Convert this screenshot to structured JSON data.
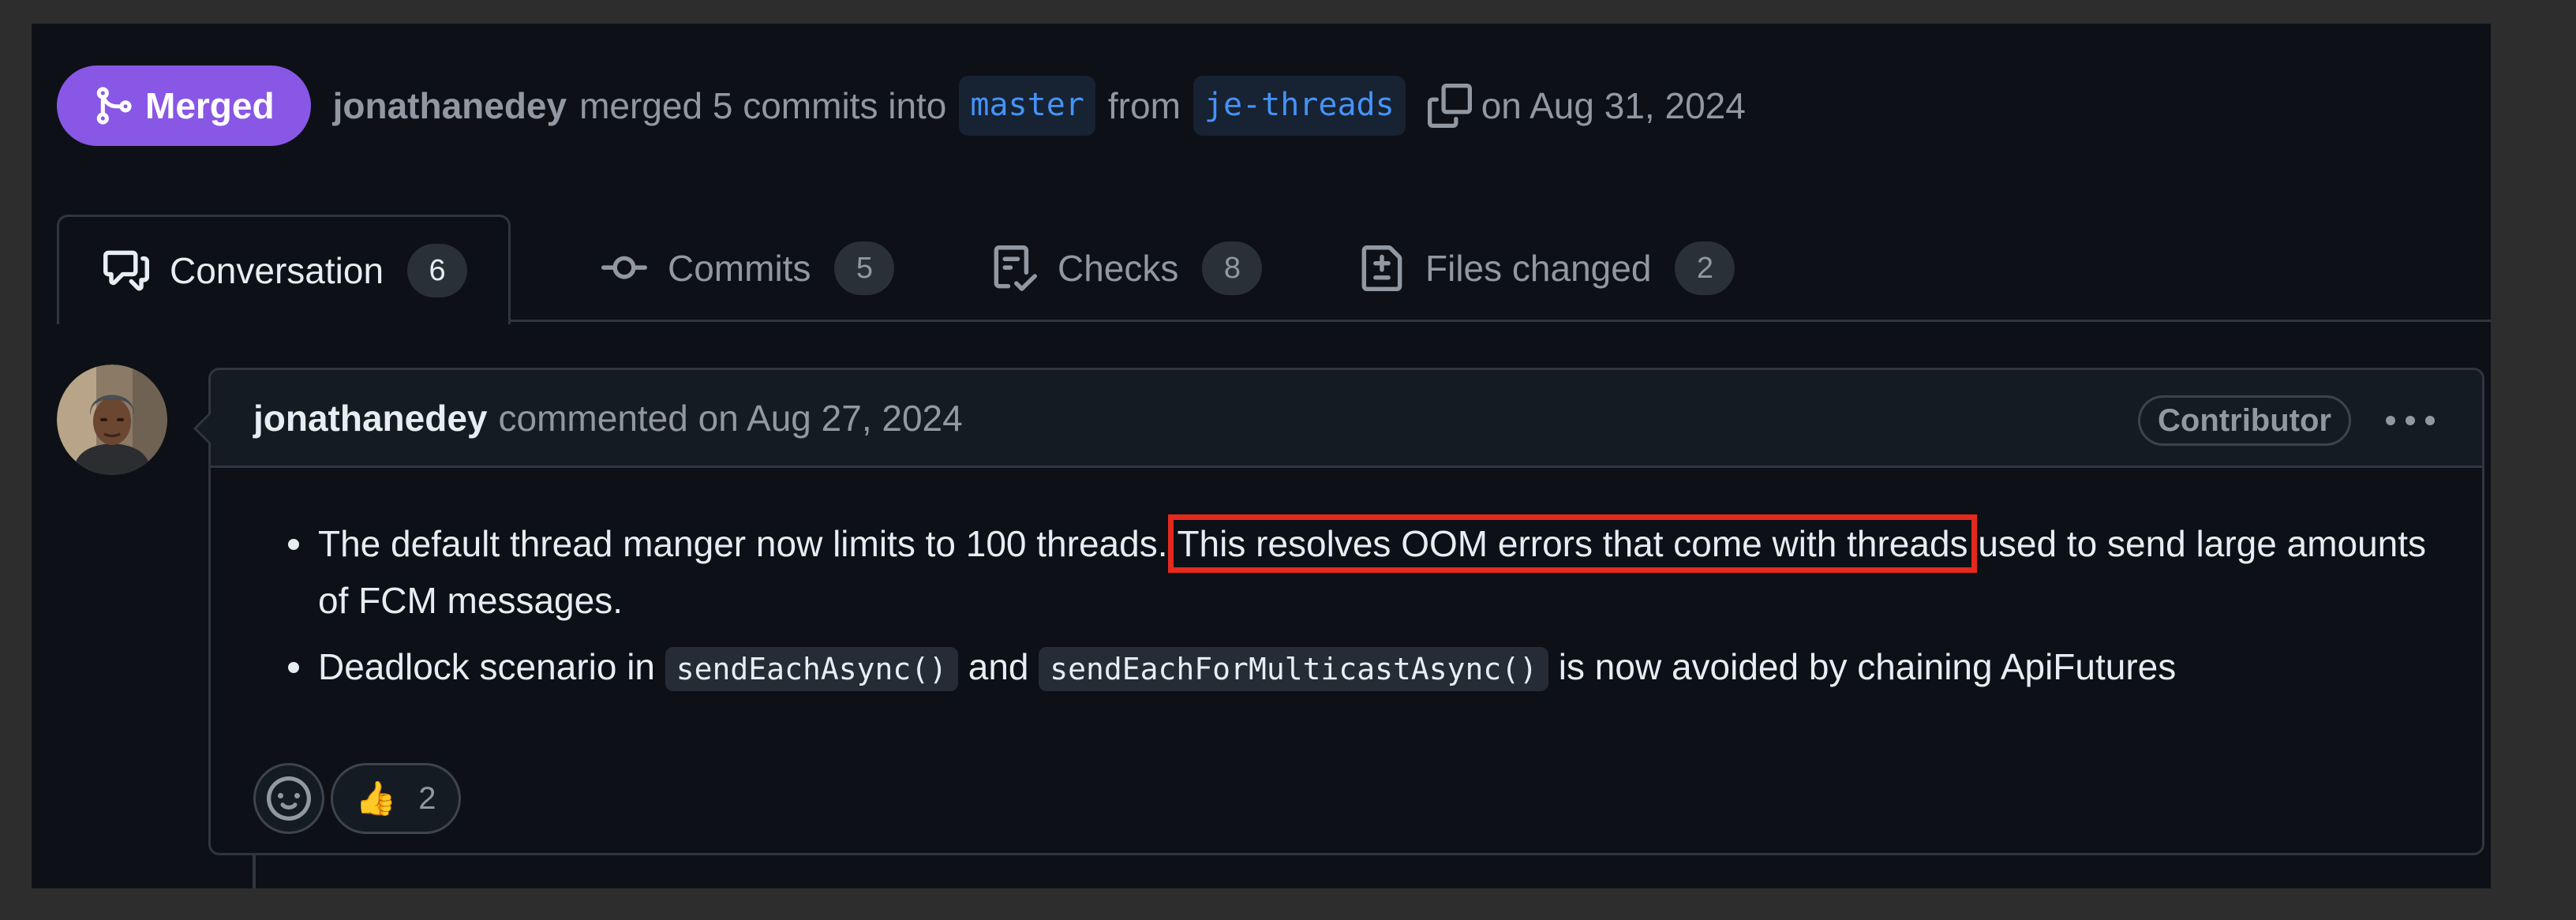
{
  "header": {
    "state": "Merged",
    "author": "jonathanedey",
    "action": "merged 5 commits into",
    "base_branch": "master",
    "from_word": "from",
    "head_branch": "je-threads",
    "date": "on Aug 31, 2024"
  },
  "tabs": [
    {
      "label": "Conversation",
      "count": "6"
    },
    {
      "label": "Commits",
      "count": "5"
    },
    {
      "label": "Checks",
      "count": "8"
    },
    {
      "label": "Files changed",
      "count": "2"
    }
  ],
  "comment": {
    "author": "jonathanedey",
    "meta": "commented on Aug 27, 2024",
    "role": "Contributor",
    "bullet1_pre": "The default thread manger now limits to 100 threads.",
    "bullet1_highlight": "This resolves OOM errors that come with threads",
    "bullet1_post": "used to send large amounts of FCM messages.",
    "bullet2_pre": "Deadlock scenario in",
    "bullet2_code1": "sendEachAsync()",
    "bullet2_and": "and",
    "bullet2_code2": "sendEachForMulticastAsync()",
    "bullet2_post": "is now avoided by chaining ApiFutures"
  },
  "reactions": {
    "emoji": "👍",
    "count": "2"
  },
  "colors": {
    "merged": "#8957e5",
    "highlight_box": "#e5291e",
    "link": "#4493f8"
  }
}
